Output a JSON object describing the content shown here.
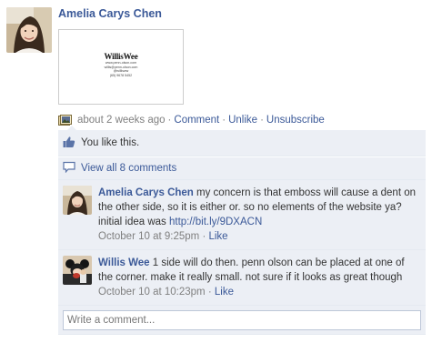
{
  "post": {
    "author": "Amelia Carys Chen",
    "attachment": {
      "logo_text": "WillisWee",
      "lines": [
        "www.penn-olson.com",
        "willis@penn-olson.com",
        "@willisww",
        "(65) 9678 5452"
      ]
    },
    "timestamp": "about 2 weeks ago",
    "actions": [
      "Comment",
      "Unlike",
      "Unsubscribe"
    ],
    "separator": "·"
  },
  "likes": {
    "text": "You like this."
  },
  "view_all": {
    "text": "View all 8 comments"
  },
  "comments": [
    {
      "author": "Amelia Carys Chen",
      "text": " my concern is that emboss will cause a dent on the other side, so it is either or. so no elements of the website ya? initial idea was ",
      "link": "http://bit.ly/9DXACN",
      "timestamp": "October 10 at 9:25pm",
      "action": "Like"
    },
    {
      "author": "Willis Wee",
      "text": " 1 side will do then. penn olson can be placed at one of the corner. make it really small. not sure if it looks as great though",
      "timestamp": "October 10 at 10:23pm",
      "action": "Like"
    }
  ],
  "write_comment": {
    "placeholder": "Write a comment..."
  },
  "colors": {
    "link": "#3b5998",
    "feedback_bg": "#eceff5",
    "meta_gray": "#808080"
  }
}
